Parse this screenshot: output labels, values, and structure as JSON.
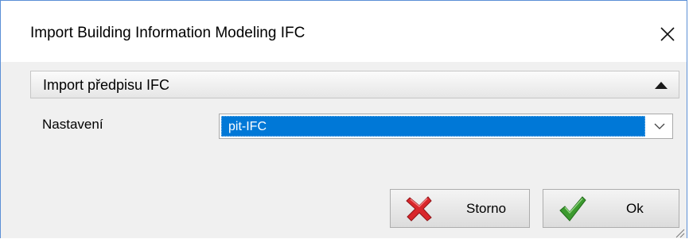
{
  "window": {
    "title": "Import Building Information Modeling IFC"
  },
  "section": {
    "title": "Import předpisu IFC"
  },
  "settings": {
    "label": "Nastavení",
    "selected_value": "pit-IFC"
  },
  "buttons": {
    "cancel_label": "Storno",
    "ok_label": "Ok"
  },
  "icons": {
    "close": "close-icon",
    "collapse": "collapse-arrow-icon",
    "dropdown": "chevron-down-icon",
    "cancel": "red-x-icon",
    "ok": "green-check-icon"
  },
  "colors": {
    "selection": "#0078d7",
    "cancel_icon": "#d9262b",
    "ok_icon": "#3c9a2f",
    "window_border": "#5b8fd6"
  }
}
